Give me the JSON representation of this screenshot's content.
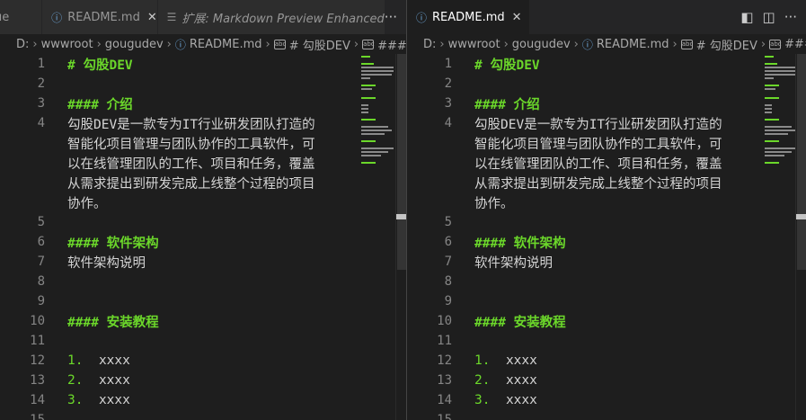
{
  "left_pane": {
    "tabs": [
      {
        "label": "ue",
        "icon": null,
        "active": false,
        "italic": false,
        "closable": false
      },
      {
        "label": "README.md",
        "icon": "info-icon",
        "active": false,
        "italic": false,
        "closable": true
      },
      {
        "label": "扩展: Markdown Preview Enhanced",
        "icon": "extension-icon",
        "active": false,
        "italic": true,
        "closable": false
      }
    ],
    "more_actions_icon": "···",
    "breadcrumb": [
      "D:",
      "wwwroot",
      "gougudev",
      "README.md",
      "# 勾股DEV",
      "#### 介"
    ]
  },
  "right_pane": {
    "tabs": [
      {
        "label": "README.md",
        "icon": "info-icon",
        "active": true,
        "italic": false,
        "closable": true
      }
    ],
    "actions": [
      "open-preview-icon",
      "split-editor-icon",
      "more-actions-icon"
    ],
    "breadcrumb": [
      "D:",
      "wwwroot",
      "gougudev",
      "README.md",
      "# 勾股DEV",
      "####"
    ]
  },
  "document": {
    "lines": [
      {
        "n": "1",
        "kind": "heading",
        "text": "# 勾股DEV"
      },
      {
        "n": "2",
        "kind": "blank",
        "text": ""
      },
      {
        "n": "3",
        "kind": "heading",
        "text": "#### 介绍"
      },
      {
        "n": "4",
        "kind": "wrapped",
        "rows": [
          "勾股DEV是一款专为IT行业研发团队打造的",
          "智能化项目管理与团队协作的工具软件，可",
          "以在线管理团队的工作、项目和任务，覆盖",
          "从需求提出到研发完成上线整个过程的项目",
          "协作。"
        ]
      },
      {
        "n": "5",
        "kind": "blank",
        "text": ""
      },
      {
        "n": "6",
        "kind": "heading",
        "text": "#### 软件架构"
      },
      {
        "n": "7",
        "kind": "text",
        "text": "软件架构说明"
      },
      {
        "n": "8",
        "kind": "blank",
        "text": ""
      },
      {
        "n": "9",
        "kind": "blank",
        "text": ""
      },
      {
        "n": "10",
        "kind": "heading",
        "text": "#### 安装教程"
      },
      {
        "n": "11",
        "kind": "blank",
        "text": ""
      },
      {
        "n": "12",
        "kind": "list",
        "marker": "1.",
        "text": "xxxx"
      },
      {
        "n": "13",
        "kind": "list",
        "marker": "2.",
        "text": "xxxx"
      },
      {
        "n": "14",
        "kind": "list",
        "marker": "3.",
        "text": "xxxx"
      },
      {
        "n": "15",
        "kind": "blank",
        "text": ""
      }
    ]
  },
  "colors": {
    "editor_bg": "#1e1e1e",
    "tabbar_bg": "#252526",
    "heading": "#6bd72a",
    "text": "#d4d4d4",
    "line_number": "#858585"
  }
}
